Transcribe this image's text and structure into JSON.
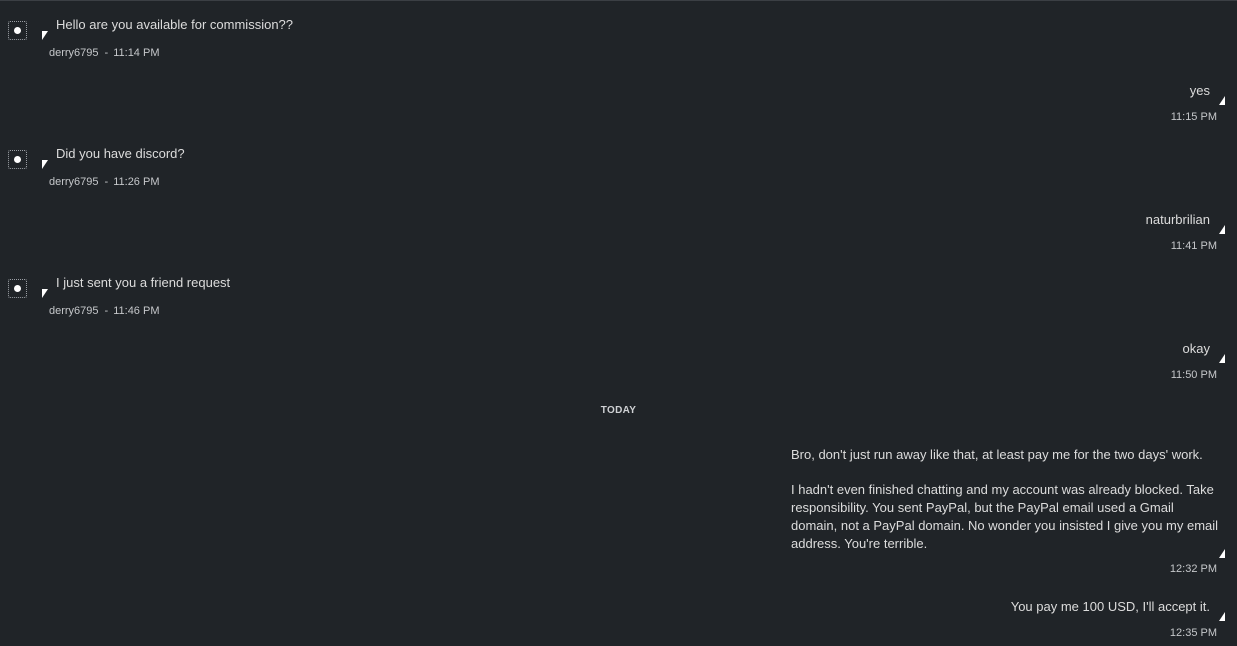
{
  "divider": {
    "label": "TODAY"
  },
  "messages": [
    {
      "direction": "in",
      "text": "Hello are you available for commission??",
      "sender": "derry6795",
      "separator": "-",
      "time": "11:14 PM"
    },
    {
      "direction": "out",
      "text": "yes",
      "time": "11:15 PM"
    },
    {
      "direction": "in",
      "text": "Did you have discord?",
      "sender": "derry6795",
      "separator": "-",
      "time": "11:26 PM"
    },
    {
      "direction": "out",
      "text": "naturbrilian",
      "time": "11:41 PM"
    },
    {
      "direction": "in",
      "text": "I just sent you a friend request",
      "sender": "derry6795",
      "separator": "-",
      "time": "11:46 PM"
    },
    {
      "direction": "out",
      "text": "okay",
      "time": "11:50 PM"
    },
    {
      "direction": "out",
      "paragraphs": [
        "Bro, don't just run away like that, at least pay me for the two days' work.",
        "I hadn't even finished chatting and my account was already blocked. Take responsibility. You sent PayPal, but the PayPal email used a Gmail domain, not a PayPal domain. No wonder you insisted I give you my email address. You're terrible."
      ],
      "time": "12:32 PM"
    },
    {
      "direction": "out",
      "text": "You pay me 100 USD, I'll accept it.",
      "time": "12:35 PM"
    }
  ]
}
